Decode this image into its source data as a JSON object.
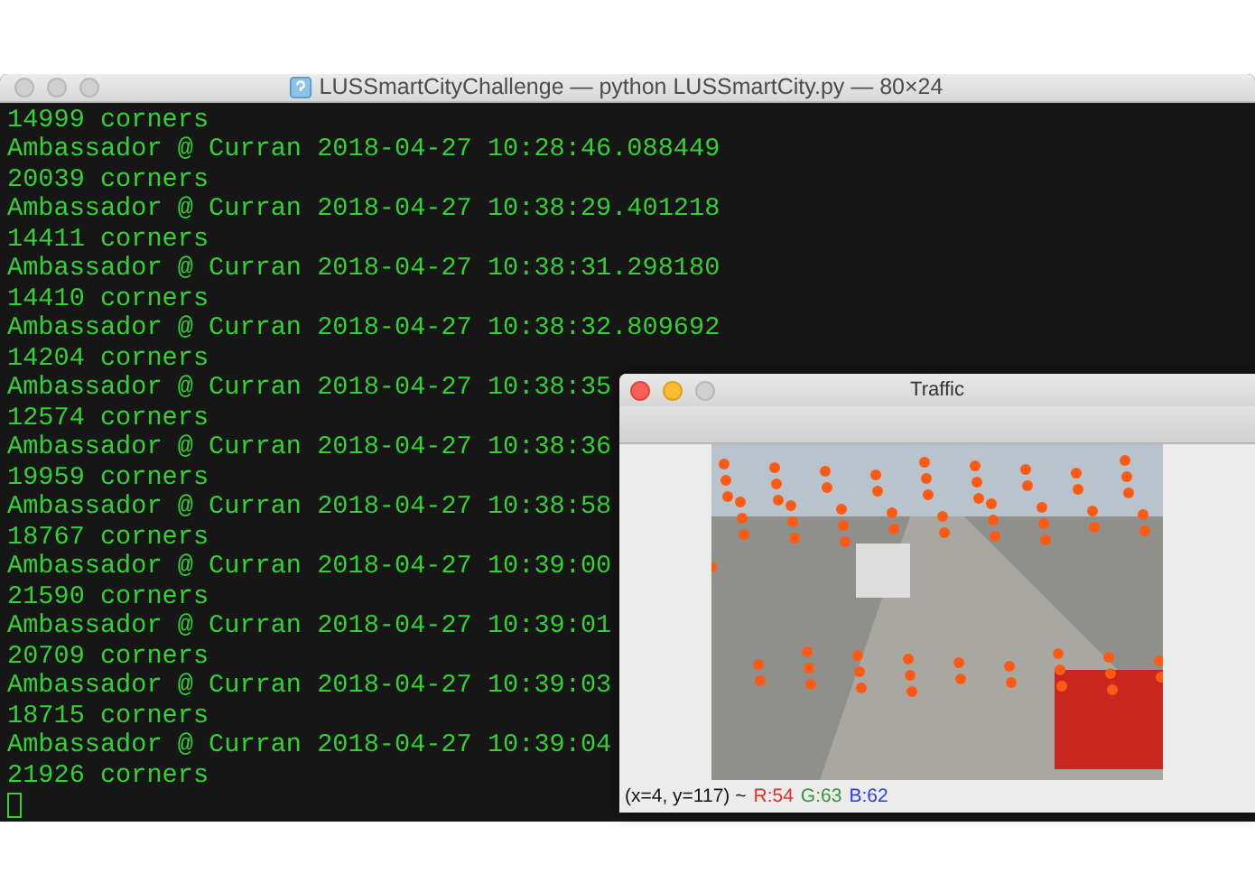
{
  "terminal": {
    "title": "LUSSmartCityChallenge — python LUSSmartCity.py — 80×24",
    "lines": [
      "14999 corners",
      "Ambassador @ Curran 2018-04-27 10:28:46.088449",
      "20039 corners",
      "Ambassador @ Curran 2018-04-27 10:38:29.401218",
      "14411 corners",
      "Ambassador @ Curran 2018-04-27 10:38:31.298180",
      "14410 corners",
      "Ambassador @ Curran 2018-04-27 10:38:32.809692",
      "14204 corners",
      "Ambassador @ Curran 2018-04-27 10:38:35",
      "12574 corners",
      "Ambassador @ Curran 2018-04-27 10:38:36",
      "19959 corners",
      "Ambassador @ Curran 2018-04-27 10:38:58",
      "18767 corners",
      "Ambassador @ Curran 2018-04-27 10:39:00",
      "21590 corners",
      "Ambassador @ Curran 2018-04-27 10:39:01",
      "20709 corners",
      "Ambassador @ Curran 2018-04-27 10:39:03",
      "18715 corners",
      "Ambassador @ Curran 2018-04-27 10:39:04",
      "21926 corners"
    ]
  },
  "traffic_window": {
    "title": "Traffic",
    "status": [
      {
        "text": "(x=4, y=117) ~",
        "color": "#111111"
      },
      {
        "text": "R:54",
        "color": "#e0302a"
      },
      {
        "text": "G:63",
        "color": "#2f9a2f"
      },
      {
        "text": "B:62",
        "color": "#2a3fe0"
      }
    ]
  }
}
